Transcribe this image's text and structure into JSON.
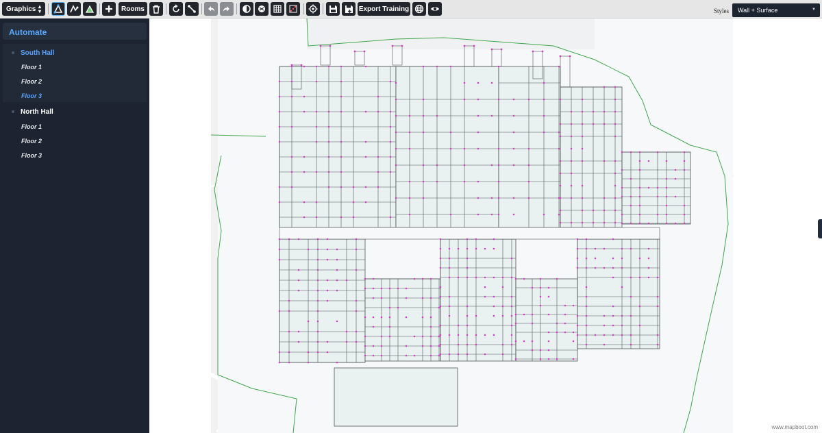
{
  "toolbar": {
    "mode_select": "Graphics",
    "rooms_label": "Rooms",
    "export_label": "Export Training",
    "styles_label": "Styles",
    "styles_value": "Wall + Surface",
    "icons": {
      "draw1": "draw-polygon-icon",
      "draw2": "draw-walls-icon",
      "draw3": "draw-surface-icon",
      "add": "plus-icon",
      "delete": "trash-icon",
      "rotate": "rotate-icon",
      "scale": "resize-icon",
      "undo": "undo-icon",
      "redo": "redo-icon",
      "snap": "snap-icon",
      "layers": "layers-icon",
      "grid": "grid-icon",
      "points": "points-icon",
      "locate": "crosshair-icon",
      "save": "save-icon",
      "save_as": "save-as-icon",
      "globe": "globe-icon",
      "eye": "eye-icon"
    }
  },
  "sidebar": {
    "title": "Automate",
    "halls": [
      {
        "name": "South Hall",
        "floors": [
          "Floor 1",
          "Floor 2",
          "Floor 3"
        ],
        "selected_floor": "Floor 3"
      },
      {
        "name": "North Hall",
        "floors": [
          "Floor 1",
          "Floor 2",
          "Floor 3"
        ]
      }
    ]
  },
  "map": {
    "attribution": "www.mapboot.com",
    "colors": {
      "wall": "#4f5256",
      "vertex": "#d33fc8",
      "boundary": "#3fa64d",
      "room_fill": "#e9f1f1"
    }
  }
}
